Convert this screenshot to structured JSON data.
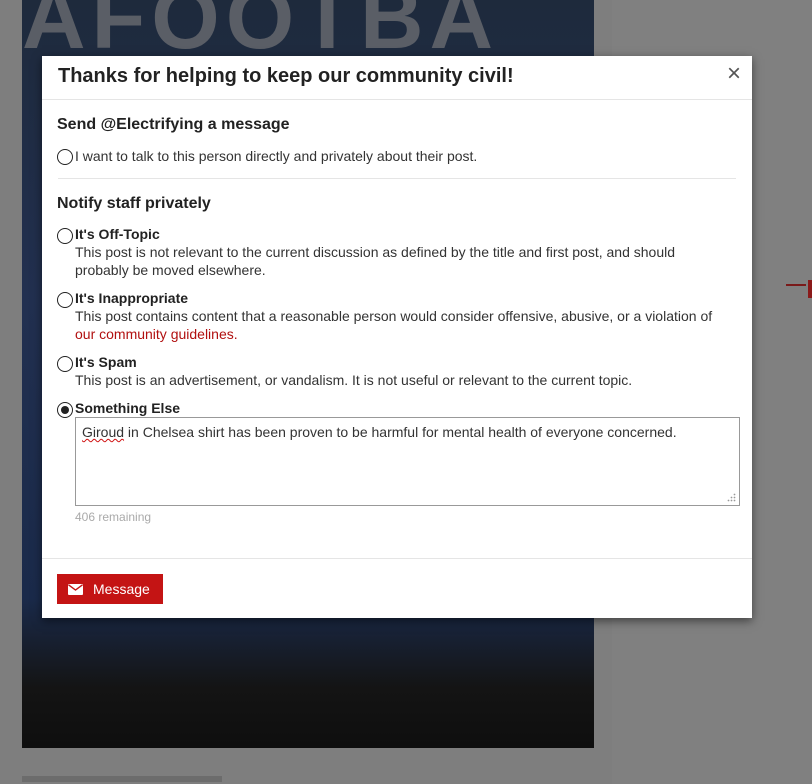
{
  "background": {
    "banner_text": "AFOOTBA"
  },
  "modal": {
    "title": "Thanks for helping to keep our community civil!",
    "close_icon": "×",
    "message_section": {
      "title": "Send @Electrifying a message",
      "option_text": "I want to talk to this person directly and privately about their post."
    },
    "staff_section": {
      "title": "Notify staff privately",
      "options": [
        {
          "label": "It's Off-Topic",
          "description_line1": "This post is not relevant to the current discussion as defined by the title and first post, and should",
          "description_line2": "probably be moved elsewhere."
        },
        {
          "label": "It's Inappropriate",
          "description_line1": "This post contains content that a reasonable person would consider offensive, abusive, or a violation of",
          "link_text": "our community guidelines",
          "link_suffix": "."
        },
        {
          "label": "It's Spam",
          "description_line1": "This post is an advertisement, or vandalism. It is not useful or relevant to the current topic."
        },
        {
          "label": "Something Else",
          "selected": true
        }
      ]
    },
    "textarea": {
      "misspelled_word": "Giroud",
      "rest_text": " in Chelsea shirt has been proven to be harmful for mental health of everyone concerned."
    },
    "remaining": "406 remaining",
    "submit_button": {
      "label": "Message",
      "icon": "envelope-icon"
    }
  },
  "colors": {
    "accent": "#c41414",
    "link": "#b11010",
    "overlay": "#808080"
  }
}
